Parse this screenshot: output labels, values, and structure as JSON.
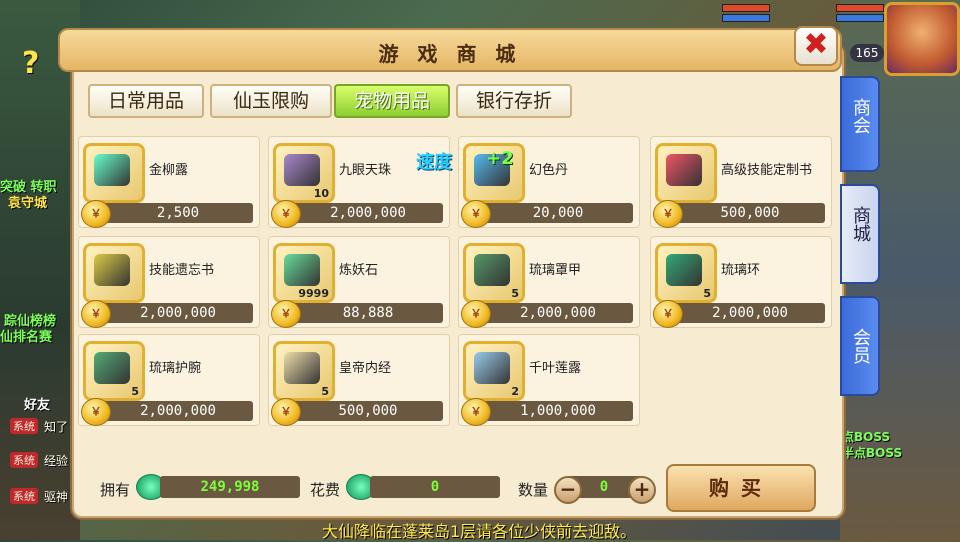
{
  "window": {
    "title": "游 戏 商 城",
    "close_label": "✖"
  },
  "tabs": [
    "日常用品",
    "仙玉限购",
    "宠物用品",
    "银行存折"
  ],
  "active_tab": 2,
  "side_tabs": [
    "商会",
    "商城",
    "会员"
  ],
  "items": [
    {
      "name": "金柳露",
      "price": "2,500",
      "qty": "",
      "color": "#6fc"
    },
    {
      "name": "九眼天珠",
      "price": "2,000,000",
      "qty": "10",
      "color": "#a8c"
    },
    {
      "name": "幻色丹",
      "price": "20,000",
      "qty": "",
      "color": "#5be"
    },
    {
      "name": "高级技能定制书",
      "price": "500,000",
      "qty": "",
      "color": "#e56"
    },
    {
      "name": "技能遗忘书",
      "price": "2,000,000",
      "qty": "",
      "color": "#dc4"
    },
    {
      "name": "炼妖石",
      "price": "88,888",
      "qty": "9999",
      "color": "#6d9"
    },
    {
      "name": "琉璃罩甲",
      "price": "2,000,000",
      "qty": "5",
      "color": "#596"
    },
    {
      "name": "琉璃环",
      "price": "2,000,000",
      "qty": "5",
      "color": "#3a7"
    },
    {
      "name": "琉璃护腕",
      "price": "2,000,000",
      "qty": "5",
      "color": "#5a7"
    },
    {
      "name": "皇帝内经",
      "price": "500,000",
      "qty": "5",
      "color": "#eda"
    },
    {
      "name": "千叶莲露",
      "price": "1,000,000",
      "qty": "2",
      "color": "#9ce"
    }
  ],
  "coin_label": "￥",
  "buff": {
    "label": "速度",
    "value": "+2"
  },
  "footer": {
    "own_label": "拥有",
    "own_value": "249,998",
    "cost_label": "花费",
    "cost_value": "0",
    "qty_label": "数量",
    "qty_value": "0",
    "minus": "−",
    "plus": "+",
    "buy_label": "购买"
  },
  "hud": {
    "level": "165"
  },
  "game_text": {
    "left1": "突破 转职",
    "left2": "袁守城",
    "left3": "踪仙榜榜",
    "left4": "仙排名赛",
    "left5": "好友",
    "boss1": "点BOSS",
    "boss2": "半点BOSS",
    "sys_label": "系统",
    "sys1": "知了",
    "sys2": "经验",
    "sys3": "驱神",
    "broadcast": "大仙降临在蓬莱岛1层请各位少侠前去迎敌。"
  }
}
